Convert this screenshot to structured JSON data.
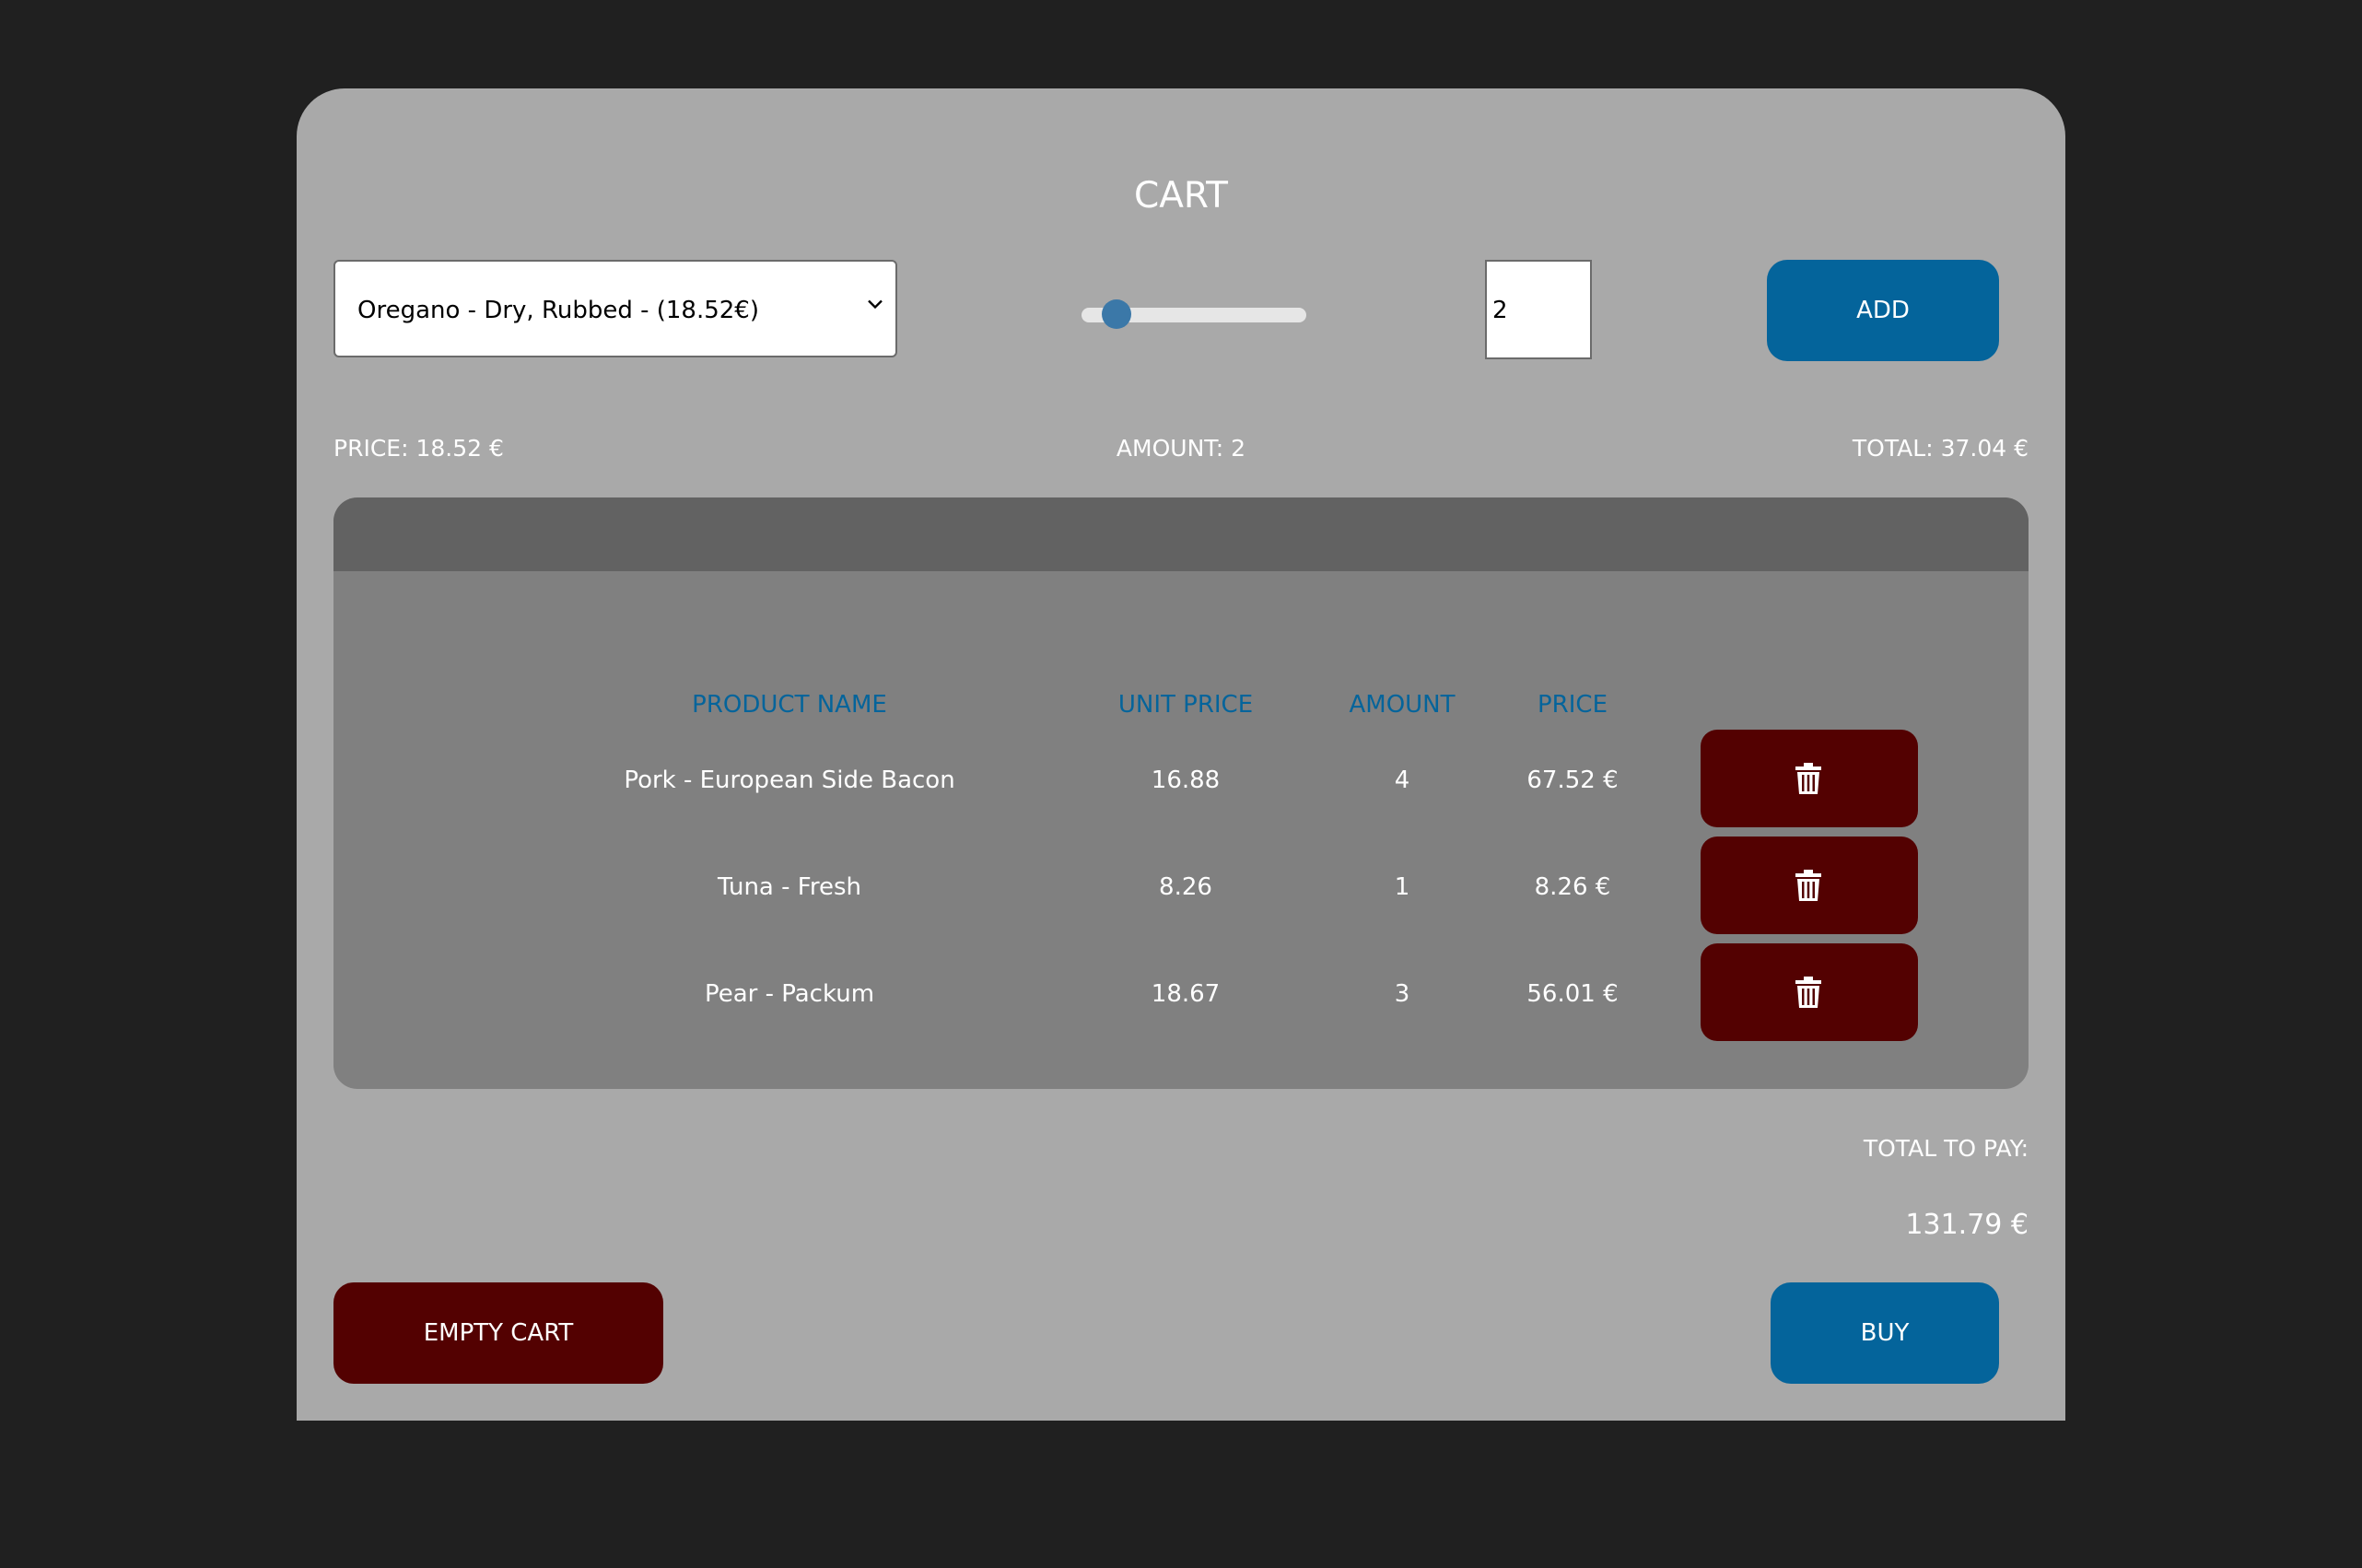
{
  "header": {
    "title": "CART"
  },
  "controls": {
    "product_select": {
      "selected": "Oregano - Dry, Rubbed - (18.52€)"
    },
    "amount_slider": {
      "value": 2
    },
    "amount_input": {
      "value": "2"
    },
    "add_label": "ADD"
  },
  "summary": {
    "price": "PRICE: 18.52 €",
    "amount": "AMOUNT: 2",
    "total": "TOTAL: 37.04 €"
  },
  "table": {
    "headers": {
      "product_name": "PRODUCT NAME",
      "unit_price": "UNIT PRICE",
      "amount": "AMOUNT",
      "price": "PRICE"
    },
    "rows": [
      {
        "name": "Pork - European Side Bacon",
        "unit_price": "16.88",
        "amount": "4",
        "price": "67.52 €"
      },
      {
        "name": "Tuna - Fresh",
        "unit_price": "8.26",
        "amount": "1",
        "price": "8.26 €"
      },
      {
        "name": "Pear - Packum",
        "unit_price": "18.67",
        "amount": "3",
        "price": "56.01 €"
      }
    ],
    "delete_icon": "trash-icon"
  },
  "footer": {
    "total_label": "TOTAL TO PAY:",
    "total_value": "131.79 €",
    "empty_label": "EMPTY CART",
    "buy_label": "BUY"
  },
  "colors": {
    "background": "#202020",
    "card": "#a9a9a9",
    "table_panel": "#808080",
    "table_topbar": "#626262",
    "primary_blue": "#04649b",
    "danger_red": "#530101",
    "slider_thumb": "#3b78a8"
  }
}
